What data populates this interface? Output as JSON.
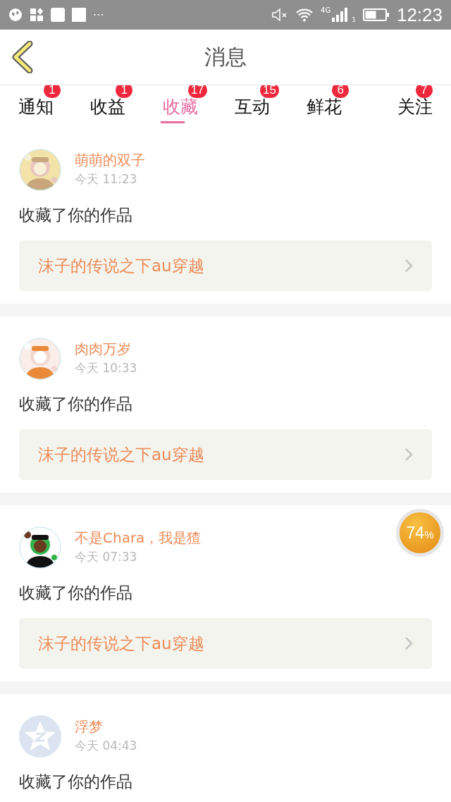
{
  "status_bar": {
    "more": "···",
    "network": "4G",
    "sim": "1",
    "time": "12:23"
  },
  "header": {
    "title": "消息"
  },
  "tabs": [
    {
      "label": "通知",
      "badge": "1",
      "selected": false
    },
    {
      "label": "收益",
      "badge": "1",
      "selected": false
    },
    {
      "label": "收藏",
      "badge": "17",
      "selected": true
    },
    {
      "label": "互动",
      "badge": "15",
      "selected": false
    },
    {
      "label": "鲜花",
      "badge": "6",
      "selected": false
    },
    {
      "label": "关注",
      "badge": "7",
      "selected": false
    }
  ],
  "messages": [
    {
      "kind": "picture",
      "name": "萌萌的双子",
      "time": "今天 11:23",
      "action": "收藏了你的作品",
      "work": "沫子的传说之下au穿越"
    },
    {
      "kind": "picture",
      "name": "肉肉万岁",
      "time": "今天 10:33",
      "action": "收藏了你的作品",
      "work": "沫子的传说之下au穿越"
    },
    {
      "kind": "picture",
      "name": "不是Chara，我是猹",
      "time": "今天 07:33",
      "action": "收藏了你的作品",
      "work": "沫子的传说之下au穿越"
    },
    {
      "kind": "default",
      "name": "浮梦",
      "time": "今天 04:43",
      "action": "收藏了你的作品"
    }
  ],
  "floating_badge": {
    "value": "74",
    "unit": "%"
  }
}
